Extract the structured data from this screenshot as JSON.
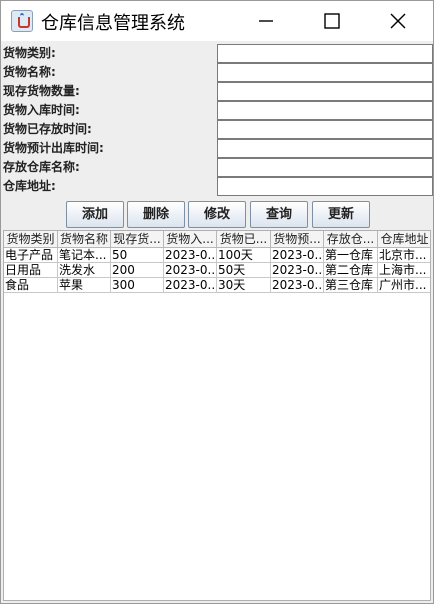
{
  "window": {
    "title": "仓库信息管理系统",
    "app_icon": "java-cup-icon",
    "controls": [
      "minimize-icon",
      "maximize-icon",
      "close-icon"
    ]
  },
  "form": {
    "fields": [
      {
        "label": "货物类别:",
        "value": ""
      },
      {
        "label": "货物名称:",
        "value": ""
      },
      {
        "label": "现存货物数量:",
        "value": ""
      },
      {
        "label": "货物入库时间:",
        "value": ""
      },
      {
        "label": "货物已存放时间:",
        "value": ""
      },
      {
        "label": "货物预计出库时间:",
        "value": ""
      },
      {
        "label": "存放仓库名称:",
        "value": ""
      },
      {
        "label": "仓库地址:",
        "value": ""
      }
    ]
  },
  "buttons": {
    "add": "添加",
    "delete": "删除",
    "modify": "修改",
    "query": "查询",
    "update": "更新"
  },
  "table": {
    "headers": [
      "货物类别",
      "货物名称",
      "现存货...",
      "货物入...",
      "货物已...",
      "货物预...",
      "存放仓...",
      "仓库地址"
    ],
    "rows": [
      [
        "电子产品",
        "笔记本...",
        "50",
        "2023-0...",
        "100天",
        "2023-0...",
        "第一仓库",
        "北京市..."
      ],
      [
        "日用品",
        "洗发水",
        "200",
        "2023-0...",
        "50天",
        "2023-0...",
        "第二仓库",
        "上海市..."
      ],
      [
        "食品",
        "苹果",
        "300",
        "2023-0...",
        "30天",
        "2023-0...",
        "第三仓库",
        "广州市..."
      ]
    ]
  }
}
